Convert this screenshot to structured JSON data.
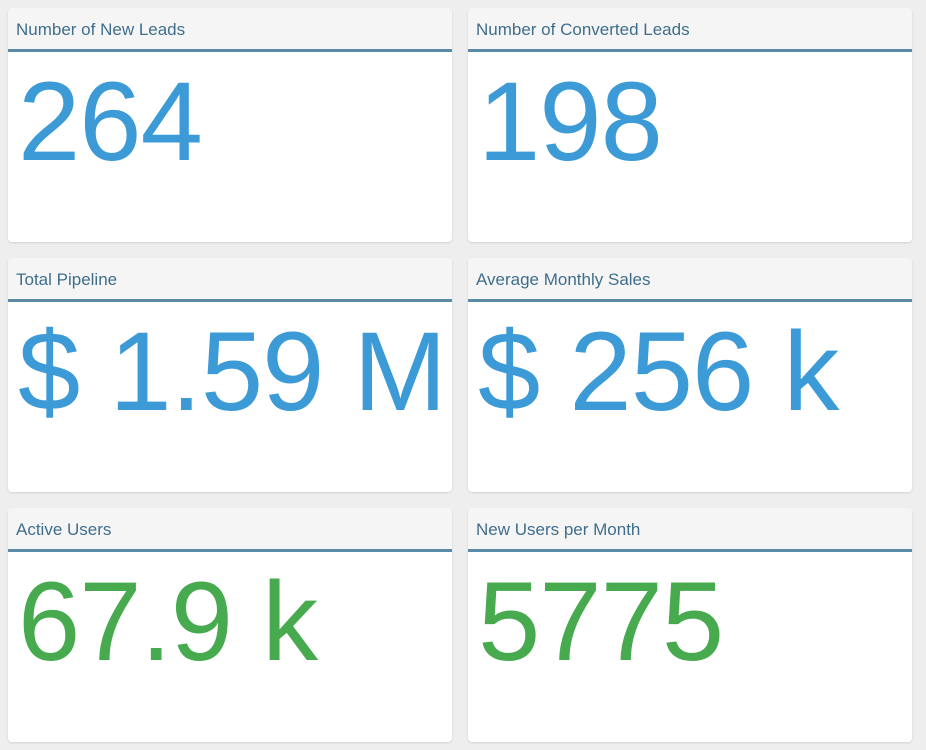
{
  "cards": [
    {
      "title": "Number of New Leads",
      "value": "264",
      "color": "#3c9ad6"
    },
    {
      "title": "Number of Converted Leads",
      "value": "198",
      "color": "#3c9ad6"
    },
    {
      "title": "Total Pipeline",
      "value": "$ 1.59 M",
      "color": "#3c9ad6"
    },
    {
      "title": "Average Monthly Sales",
      "value": "$ 256 k",
      "color": "#3c9ad6"
    },
    {
      "title": "Active Users",
      "value": "67.9 k",
      "color": "#47aa4f"
    },
    {
      "title": "New Users per Month",
      "value": "5775",
      "color": "#47aa4f"
    }
  ],
  "theme": {
    "header_border": "#5b8aa6",
    "title_color": "#3f6e8c",
    "background": "#eeeeee"
  }
}
